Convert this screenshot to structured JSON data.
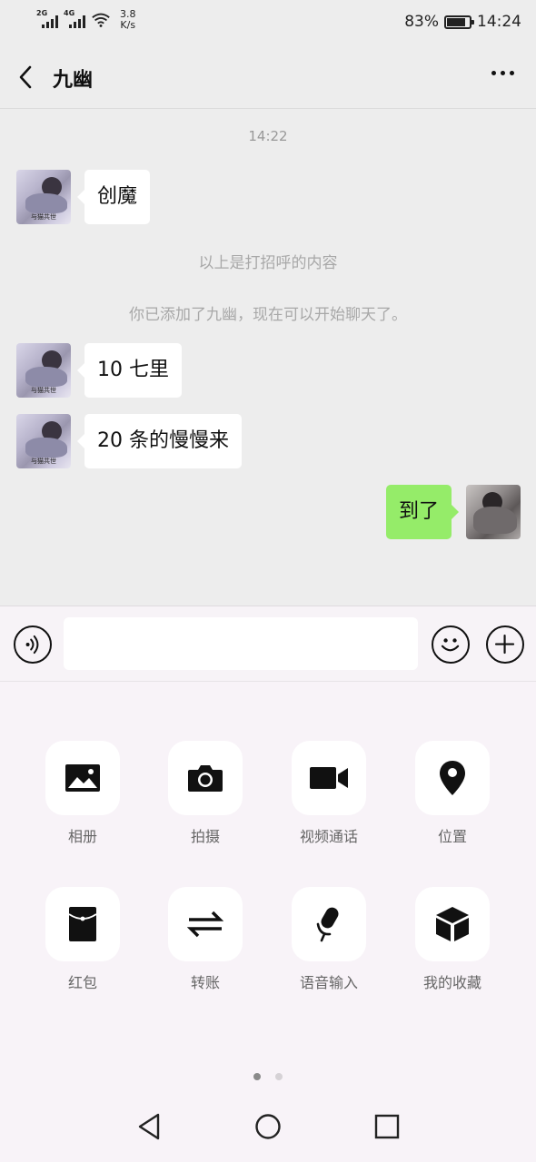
{
  "status_bar": {
    "net1": "2G",
    "net2": "4G",
    "speed_value": "3.8",
    "speed_unit": "K/s",
    "battery": "83%",
    "battery_level": 0.83,
    "time": "14:24"
  },
  "header": {
    "title": "九幽"
  },
  "chat": {
    "timestamp": "14:22",
    "messages": [
      {
        "side": "left",
        "text": "创魔"
      },
      {
        "side": "left",
        "text": "10 七里"
      },
      {
        "side": "left",
        "text": "20 条的慢慢来"
      },
      {
        "side": "right",
        "text": "到了"
      }
    ],
    "system_notes": [
      "以上是打招呼的内容",
      "你已添加了九幽，现在可以开始聊天了。"
    ],
    "avatar_caption": "与猫共世"
  },
  "panel": {
    "tiles": [
      {
        "label": "相册",
        "icon": "album-icon"
      },
      {
        "label": "拍摄",
        "icon": "camera-icon"
      },
      {
        "label": "视频通话",
        "icon": "video-call-icon"
      },
      {
        "label": "位置",
        "icon": "location-icon"
      },
      {
        "label": "红包",
        "icon": "red-packet-icon"
      },
      {
        "label": "转账",
        "icon": "transfer-icon"
      },
      {
        "label": "语音输入",
        "icon": "microphone-icon"
      },
      {
        "label": "我的收藏",
        "icon": "favorites-icon"
      }
    ],
    "page_count": 2,
    "current_page": 1
  }
}
